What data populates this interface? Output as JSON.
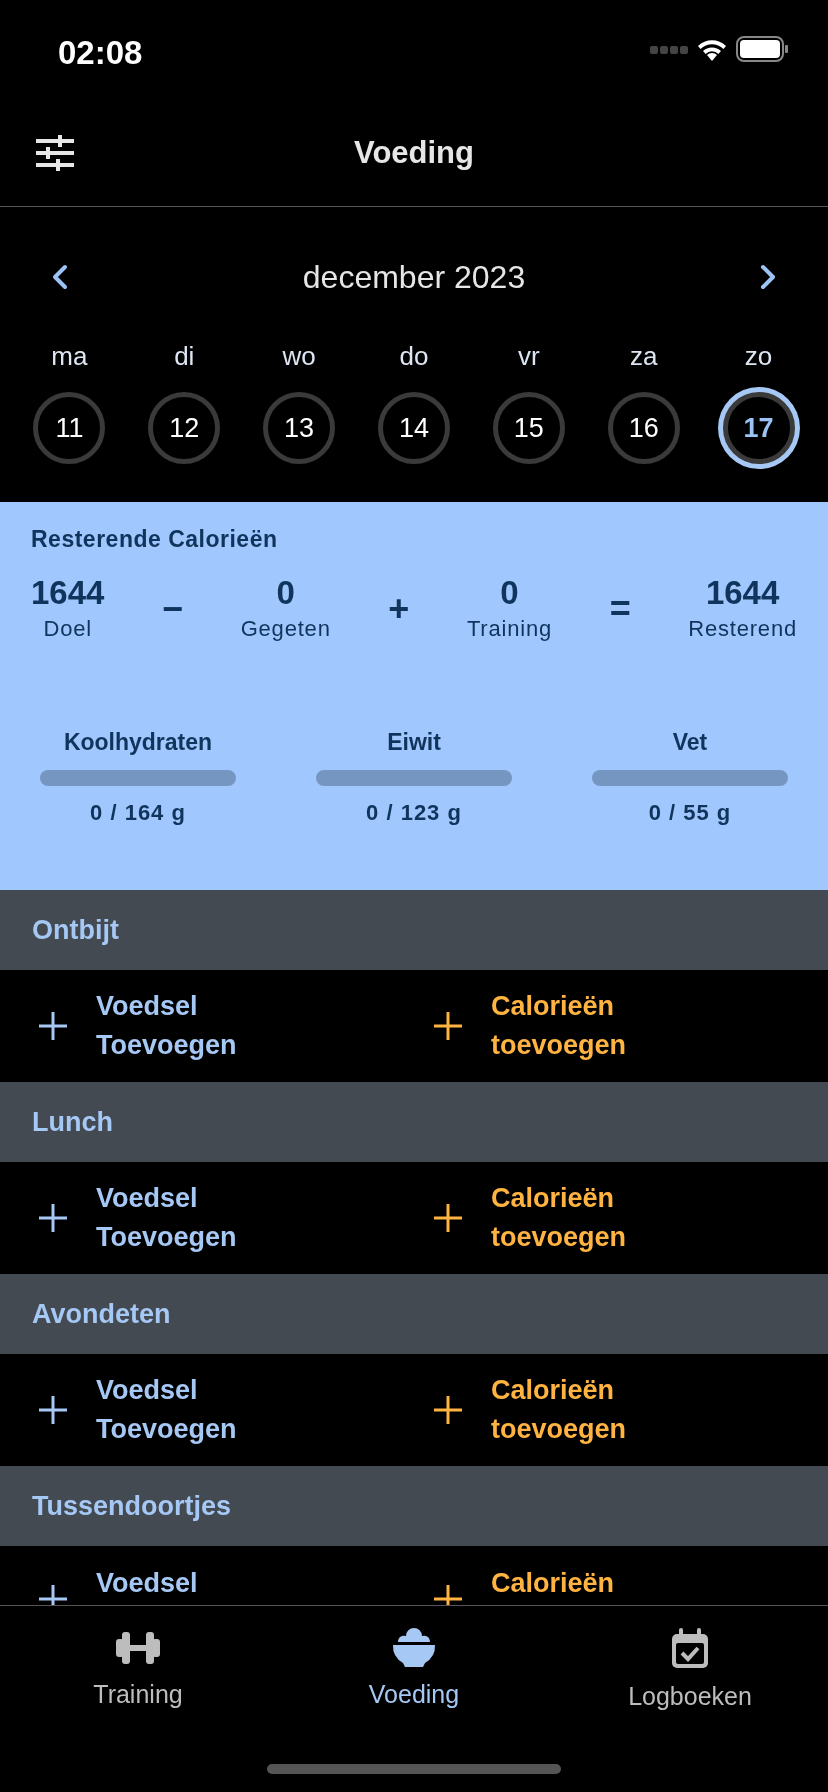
{
  "status_bar": {
    "time": "02:08"
  },
  "header": {
    "title": "Voeding"
  },
  "calendar": {
    "month": "december 2023",
    "days": [
      {
        "weekday": "ma",
        "day": "11",
        "selected": false
      },
      {
        "weekday": "di",
        "day": "12",
        "selected": false
      },
      {
        "weekday": "wo",
        "day": "13",
        "selected": false
      },
      {
        "weekday": "do",
        "day": "14",
        "selected": false
      },
      {
        "weekday": "vr",
        "day": "15",
        "selected": false
      },
      {
        "weekday": "za",
        "day": "16",
        "selected": false
      },
      {
        "weekday": "zo",
        "day": "17",
        "selected": true
      }
    ]
  },
  "summary": {
    "title": "Resterende Calorieën",
    "equation": [
      {
        "kind": "value",
        "value": "1644",
        "label": "Doel"
      },
      {
        "kind": "operator",
        "symbol": "−"
      },
      {
        "kind": "value",
        "value": "0",
        "label": "Gegeten"
      },
      {
        "kind": "operator",
        "symbol": "+"
      },
      {
        "kind": "value",
        "value": "0",
        "label": "Training"
      },
      {
        "kind": "operator",
        "symbol": "="
      },
      {
        "kind": "value",
        "value": "1644",
        "label": "Resterend"
      }
    ],
    "macros": [
      {
        "name": "Koolhydraten",
        "level": 0,
        "reading": "0 / 164 g"
      },
      {
        "name": "Eiwit",
        "level": 0,
        "reading": "0 / 123 g"
      },
      {
        "name": "Vet",
        "level": 0,
        "reading": "0 / 55 g"
      }
    ]
  },
  "meals": [
    {
      "name": "Ontbijt",
      "food_action": "Voedsel Toevoegen",
      "calorie_action": "Calorieën toevoegen"
    },
    {
      "name": "Lunch",
      "food_action": "Voedsel Toevoegen",
      "calorie_action": "Calorieën toevoegen"
    },
    {
      "name": "Avondeten",
      "food_action": "Voedsel Toevoegen",
      "calorie_action": "Calorieën toevoegen"
    },
    {
      "name": "Tussendoortjes",
      "food_action": "Voedsel",
      "calorie_action": "Calorieën"
    }
  ],
  "tab_bar": [
    {
      "kind": "dumbbell",
      "label": "Training",
      "selected": false
    },
    {
      "kind": "bowl",
      "label": "Voeding",
      "selected": true
    },
    {
      "kind": "calendar",
      "label": "Logboeken",
      "selected": false
    }
  ]
}
